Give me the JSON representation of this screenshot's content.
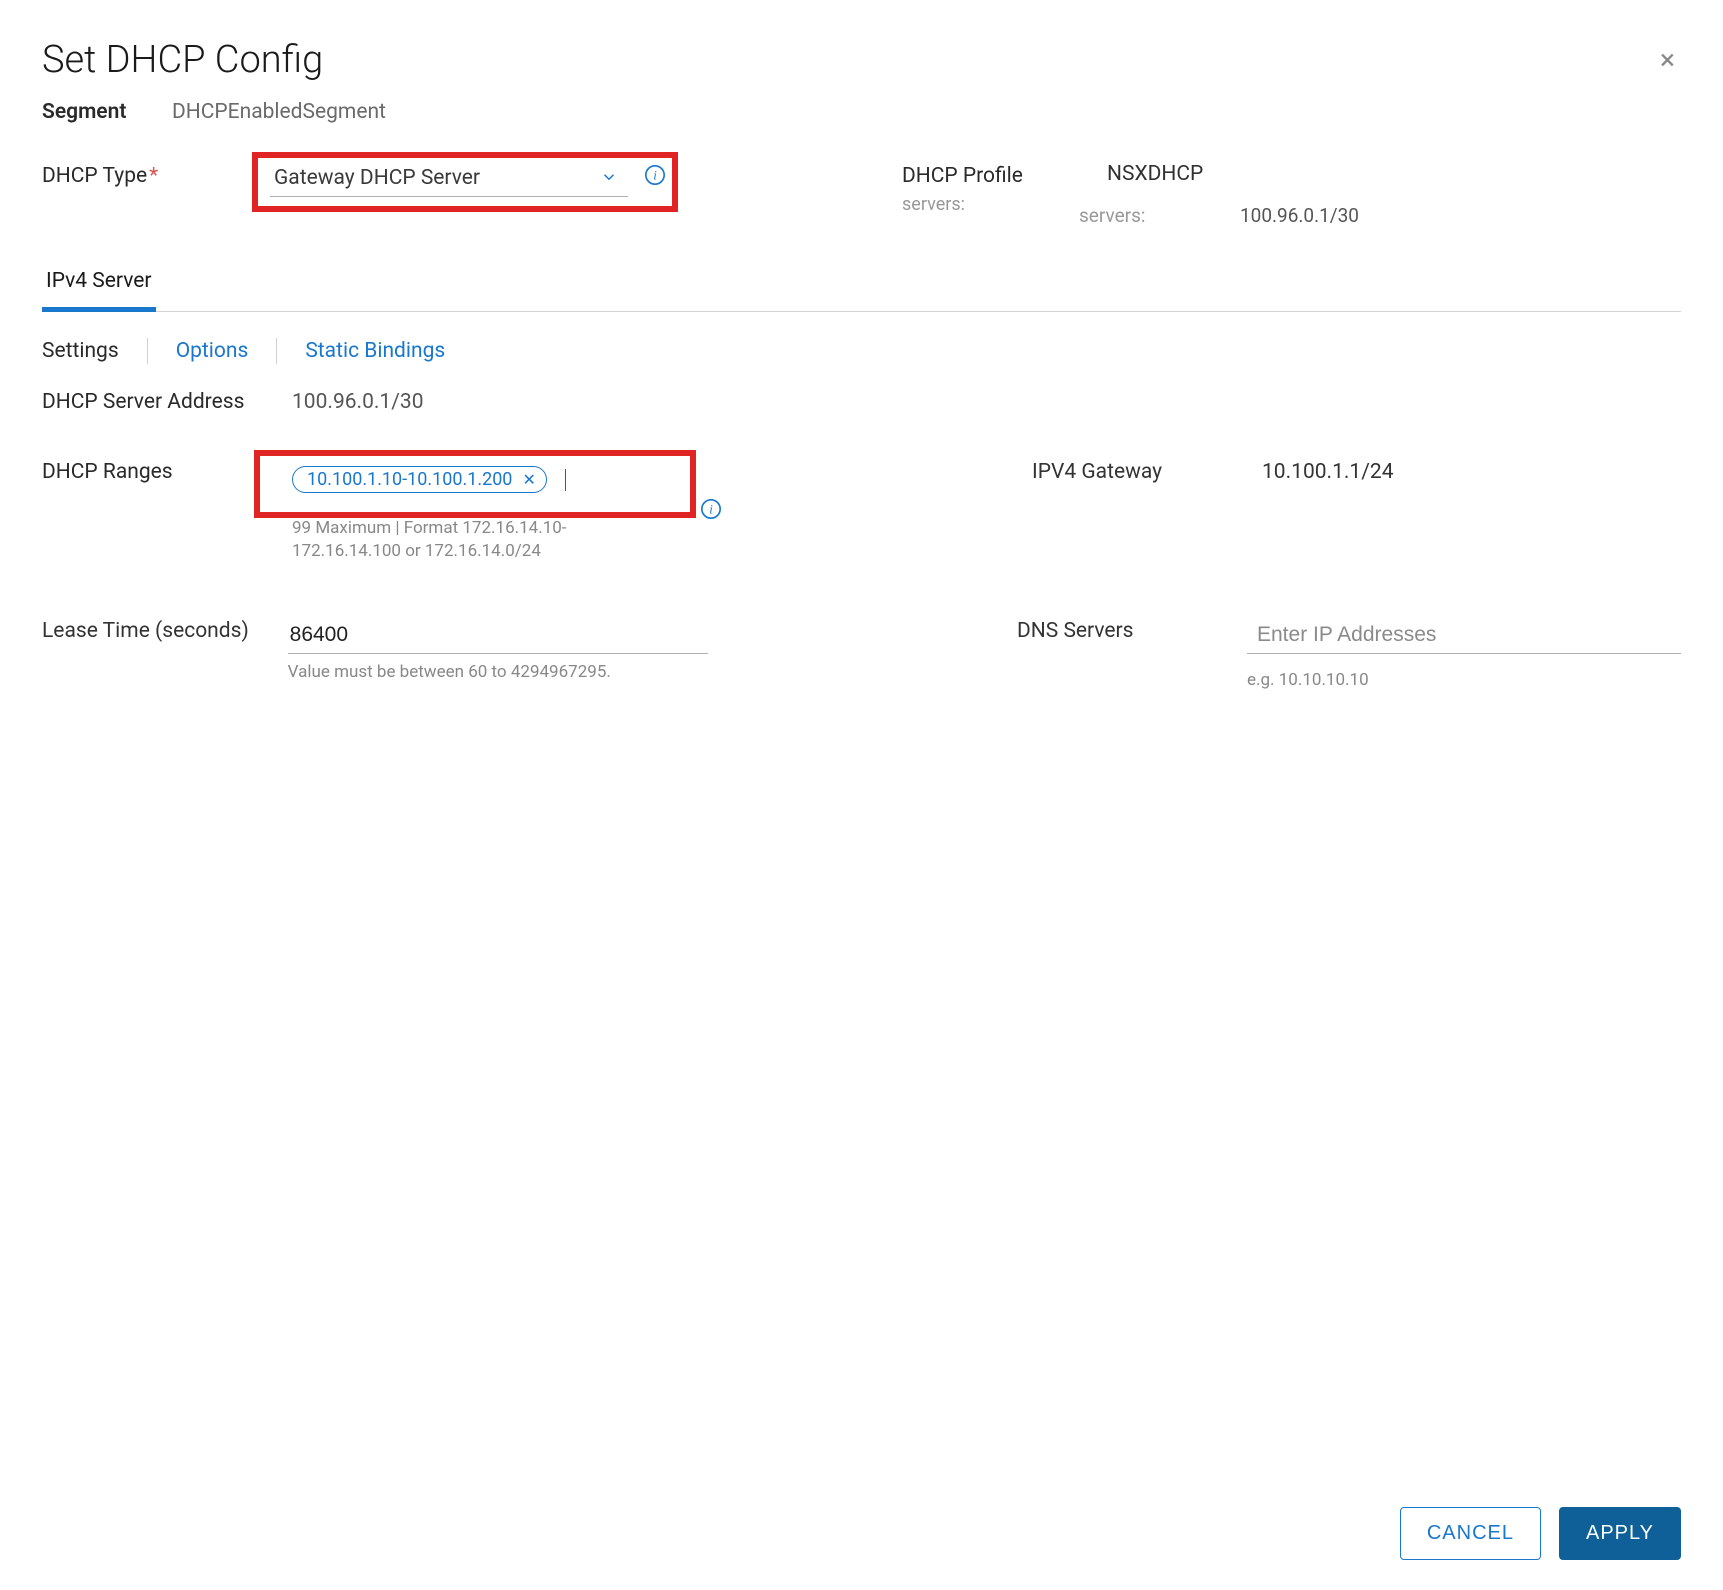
{
  "dialog": {
    "title": "Set DHCP Config",
    "close_label": "×"
  },
  "segment": {
    "label": "Segment",
    "value": "DHCPEnabledSegment"
  },
  "dhcp_type": {
    "label": "DHCP Type",
    "selected": "Gateway DHCP Server"
  },
  "dhcp_profile": {
    "label": "DHCP Profile",
    "value": "NSXDHCP",
    "sub_label": "servers:",
    "sub_value": "100.96.0.1/30"
  },
  "main_tabs": {
    "ipv4": "IPv4 Server"
  },
  "sub_tabs": {
    "settings": "Settings",
    "options": "Options",
    "static_bindings": "Static Bindings"
  },
  "server_addr": {
    "label": "DHCP Server Address",
    "value": "100.96.0.1/30"
  },
  "ranges": {
    "label": "DHCP Ranges",
    "chip": "10.100.1.10-10.100.1.200",
    "help": "99 Maximum | Format 172.16.14.10-172.16.14.100 or 172.16.14.0/24"
  },
  "ipv4_gateway": {
    "label": "IPV4 Gateway",
    "value": "10.100.1.1/24"
  },
  "lease": {
    "label": "Lease Time (seconds)",
    "value": "86400",
    "help": "Value must be between 60 to 4294967295."
  },
  "dns": {
    "label": "DNS Servers",
    "placeholder": "Enter IP Addresses",
    "help": "e.g. 10.10.10.10"
  },
  "footer": {
    "cancel": "CANCEL",
    "apply": "APPLY"
  }
}
